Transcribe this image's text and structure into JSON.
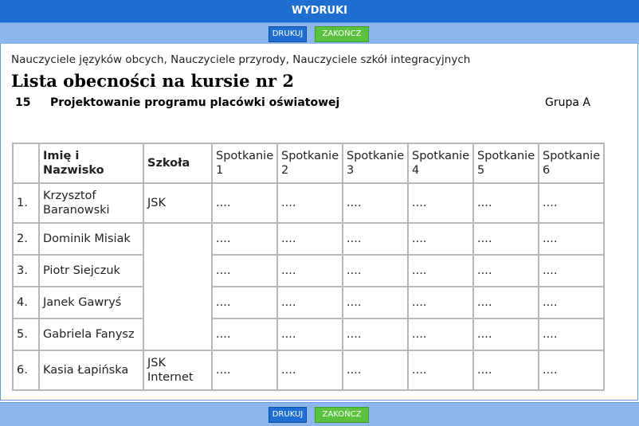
{
  "window": {
    "title": "WYDRUKI"
  },
  "toolbar": {
    "print_label": "DRUKUJ",
    "close_label": "ZAKOŃCZ"
  },
  "document": {
    "subtitle": "Nauczyciele języków obcych, Nauczyciele przyrody, Nauczyciele szkół integracyjnych",
    "heading": "Lista obecności na kursie nr 2",
    "course_number": "15",
    "course_name": "Projektowanie programu placówki oświatowej",
    "group": "Grupa A"
  },
  "table": {
    "headers": {
      "name": "Imię i Nazwisko",
      "school": "Szkoła",
      "meetings": [
        "Spotkanie 1",
        "Spotkanie 2",
        "Spotkanie 3",
        "Spotkanie 4",
        "Spotkanie 5",
        "Spotkanie 6"
      ]
    },
    "placeholder": "....",
    "rows": [
      {
        "num": "1.",
        "name": "Krzysztof Baranowski",
        "school": "JSK"
      },
      {
        "num": "2.",
        "name": "Dominik Misiak",
        "school": ""
      },
      {
        "num": "3.",
        "name": "Piotr Siejczuk",
        "school": ""
      },
      {
        "num": "4.",
        "name": "Janek Gawryś",
        "school": ""
      },
      {
        "num": "5.",
        "name": "Gabriela Fanysz",
        "school": ""
      },
      {
        "num": "6.",
        "name": "Kasia Łapińska",
        "school": "JSK Internet"
      }
    ]
  }
}
